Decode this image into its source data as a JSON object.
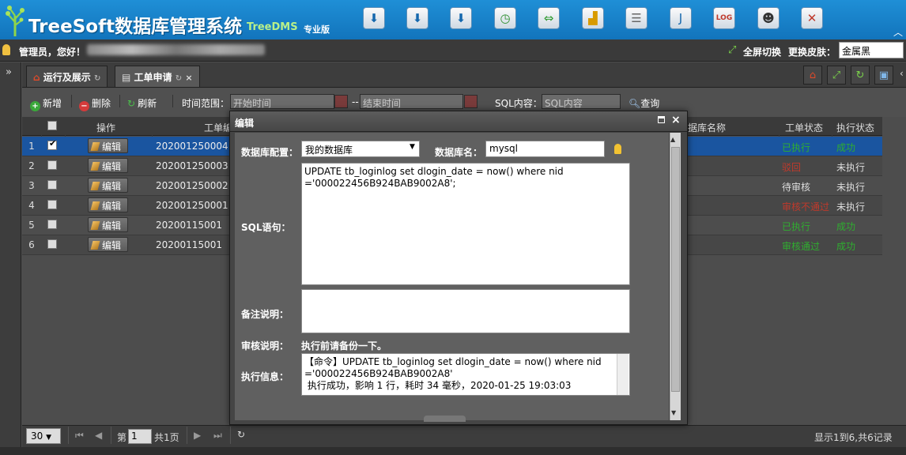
{
  "header": {
    "title": "TreeSoft数据库管理系统",
    "subtitle": "TreeDMS",
    "edition": "专业版",
    "toolbar_icons": [
      "db-import-icon",
      "db-export-icon",
      "db-sync-icon",
      "clock-icon",
      "swap-arrows-icon",
      "chart-icon",
      "database-icon",
      "java-icon",
      "log-icon",
      "user-icon",
      "tools-icon"
    ]
  },
  "userbar": {
    "greeting": "管理员，您好！",
    "fullscreen_label": "全屏切换",
    "skin_label": "更换皮肤：",
    "skin_value": "金属黑"
  },
  "tabs": [
    {
      "label": "运行及展示"
    },
    {
      "label": "工单申请"
    }
  ],
  "toolbar": {
    "add": "新增",
    "delete": "删除",
    "refresh": "刷新",
    "time_range_label": "时间范围：",
    "start_placeholder": "开始时间",
    "separator": "--",
    "end_placeholder": "结束时间",
    "sql_label": "SQL内容：",
    "sql_placeholder": "SQL内容",
    "query": "查询"
  },
  "grid": {
    "columns": [
      "操作",
      "工单编",
      "据库名称",
      "工单状态",
      "执行状态"
    ],
    "edit_label": "编辑",
    "rows": [
      {
        "num": "1",
        "order": "202001250004",
        "status": "已执行",
        "exec": "成功",
        "status_color": "#2fae2f",
        "exec_color": "#2fae2f"
      },
      {
        "num": "2",
        "order": "202001250003",
        "status": "驳回",
        "exec": "未执行",
        "status_color": "#c0392b",
        "exec_color": "#dddddd"
      },
      {
        "num": "3",
        "order": "202001250002",
        "status": "待审核",
        "exec": "未执行",
        "status_color": "#dddddd",
        "exec_color": "#dddddd"
      },
      {
        "num": "4",
        "order": "202001250001",
        "status": "审核不通过",
        "exec": "未执行",
        "status_color": "#c0392b",
        "exec_color": "#dddddd"
      },
      {
        "num": "5",
        "order": "20200115001",
        "status": "已执行",
        "exec": "成功",
        "status_color": "#2fae2f",
        "exec_color": "#2fae2f"
      },
      {
        "num": "6",
        "order": "20200115001",
        "status": "审核通过",
        "exec": "成功",
        "status_color": "#2fae2f",
        "exec_color": "#2fae2f"
      }
    ]
  },
  "pager": {
    "page_size": "30",
    "page_label": "第",
    "page_value": "1",
    "total_pages": "共1页",
    "summary": "显示1到6,共6记录"
  },
  "dialog": {
    "title": "编辑",
    "db_config_label": "数据库配置：",
    "db_config_value": "我的数据库",
    "db_name_label": "数据库名：",
    "db_name_value": "mysql",
    "sql_label": "SQL语句：",
    "sql_value": "UPDATE tb_loginlog set dlogin_date = now() where nid\n='000022456B924BAB9002A8';",
    "note_label": "备注说明：",
    "note_value": "",
    "audit_label": "审核说明：",
    "audit_value": "执行前请备份一下。",
    "exec_label": "执行信息：",
    "exec_value": "【命令】UPDATE tb_loginlog set dlogin_date = now() where nid\n='000022456B924BAB9002A8'\n 执行成功，影响 1 行，耗时 34 毫秒，2020-01-25 19:03:03"
  }
}
